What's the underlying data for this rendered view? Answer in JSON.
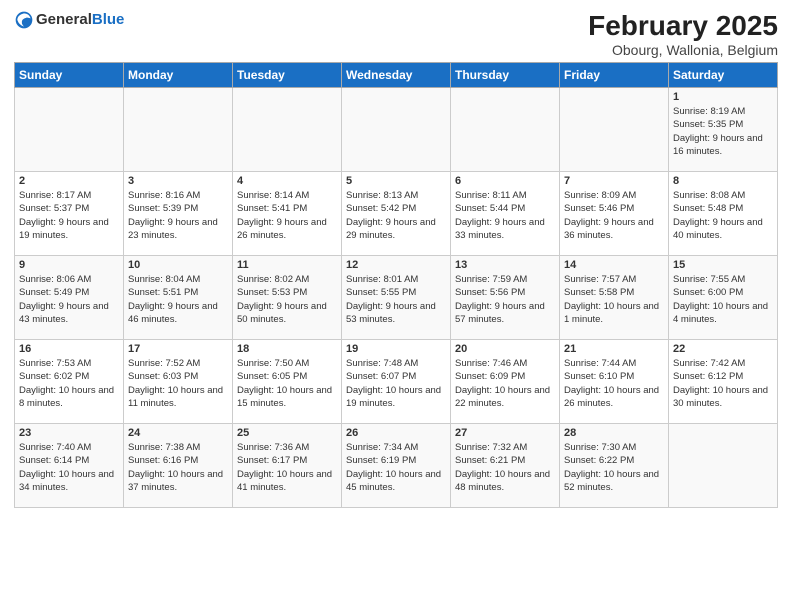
{
  "header": {
    "logo_general": "General",
    "logo_blue": "Blue",
    "title": "February 2025",
    "subtitle": "Obourg, Wallonia, Belgium"
  },
  "weekdays": [
    "Sunday",
    "Monday",
    "Tuesday",
    "Wednesday",
    "Thursday",
    "Friday",
    "Saturday"
  ],
  "weeks": [
    [
      {
        "day": "",
        "info": ""
      },
      {
        "day": "",
        "info": ""
      },
      {
        "day": "",
        "info": ""
      },
      {
        "day": "",
        "info": ""
      },
      {
        "day": "",
        "info": ""
      },
      {
        "day": "",
        "info": ""
      },
      {
        "day": "1",
        "info": "Sunrise: 8:19 AM\nSunset: 5:35 PM\nDaylight: 9 hours and 16 minutes."
      }
    ],
    [
      {
        "day": "2",
        "info": "Sunrise: 8:17 AM\nSunset: 5:37 PM\nDaylight: 9 hours and 19 minutes."
      },
      {
        "day": "3",
        "info": "Sunrise: 8:16 AM\nSunset: 5:39 PM\nDaylight: 9 hours and 23 minutes."
      },
      {
        "day": "4",
        "info": "Sunrise: 8:14 AM\nSunset: 5:41 PM\nDaylight: 9 hours and 26 minutes."
      },
      {
        "day": "5",
        "info": "Sunrise: 8:13 AM\nSunset: 5:42 PM\nDaylight: 9 hours and 29 minutes."
      },
      {
        "day": "6",
        "info": "Sunrise: 8:11 AM\nSunset: 5:44 PM\nDaylight: 9 hours and 33 minutes."
      },
      {
        "day": "7",
        "info": "Sunrise: 8:09 AM\nSunset: 5:46 PM\nDaylight: 9 hours and 36 minutes."
      },
      {
        "day": "8",
        "info": "Sunrise: 8:08 AM\nSunset: 5:48 PM\nDaylight: 9 hours and 40 minutes."
      }
    ],
    [
      {
        "day": "9",
        "info": "Sunrise: 8:06 AM\nSunset: 5:49 PM\nDaylight: 9 hours and 43 minutes."
      },
      {
        "day": "10",
        "info": "Sunrise: 8:04 AM\nSunset: 5:51 PM\nDaylight: 9 hours and 46 minutes."
      },
      {
        "day": "11",
        "info": "Sunrise: 8:02 AM\nSunset: 5:53 PM\nDaylight: 9 hours and 50 minutes."
      },
      {
        "day": "12",
        "info": "Sunrise: 8:01 AM\nSunset: 5:55 PM\nDaylight: 9 hours and 53 minutes."
      },
      {
        "day": "13",
        "info": "Sunrise: 7:59 AM\nSunset: 5:56 PM\nDaylight: 9 hours and 57 minutes."
      },
      {
        "day": "14",
        "info": "Sunrise: 7:57 AM\nSunset: 5:58 PM\nDaylight: 10 hours and 1 minute."
      },
      {
        "day": "15",
        "info": "Sunrise: 7:55 AM\nSunset: 6:00 PM\nDaylight: 10 hours and 4 minutes."
      }
    ],
    [
      {
        "day": "16",
        "info": "Sunrise: 7:53 AM\nSunset: 6:02 PM\nDaylight: 10 hours and 8 minutes."
      },
      {
        "day": "17",
        "info": "Sunrise: 7:52 AM\nSunset: 6:03 PM\nDaylight: 10 hours and 11 minutes."
      },
      {
        "day": "18",
        "info": "Sunrise: 7:50 AM\nSunset: 6:05 PM\nDaylight: 10 hours and 15 minutes."
      },
      {
        "day": "19",
        "info": "Sunrise: 7:48 AM\nSunset: 6:07 PM\nDaylight: 10 hours and 19 minutes."
      },
      {
        "day": "20",
        "info": "Sunrise: 7:46 AM\nSunset: 6:09 PM\nDaylight: 10 hours and 22 minutes."
      },
      {
        "day": "21",
        "info": "Sunrise: 7:44 AM\nSunset: 6:10 PM\nDaylight: 10 hours and 26 minutes."
      },
      {
        "day": "22",
        "info": "Sunrise: 7:42 AM\nSunset: 6:12 PM\nDaylight: 10 hours and 30 minutes."
      }
    ],
    [
      {
        "day": "23",
        "info": "Sunrise: 7:40 AM\nSunset: 6:14 PM\nDaylight: 10 hours and 34 minutes."
      },
      {
        "day": "24",
        "info": "Sunrise: 7:38 AM\nSunset: 6:16 PM\nDaylight: 10 hours and 37 minutes."
      },
      {
        "day": "25",
        "info": "Sunrise: 7:36 AM\nSunset: 6:17 PM\nDaylight: 10 hours and 41 minutes."
      },
      {
        "day": "26",
        "info": "Sunrise: 7:34 AM\nSunset: 6:19 PM\nDaylight: 10 hours and 45 minutes."
      },
      {
        "day": "27",
        "info": "Sunrise: 7:32 AM\nSunset: 6:21 PM\nDaylight: 10 hours and 48 minutes."
      },
      {
        "day": "28",
        "info": "Sunrise: 7:30 AM\nSunset: 6:22 PM\nDaylight: 10 hours and 52 minutes."
      },
      {
        "day": "",
        "info": ""
      }
    ]
  ]
}
